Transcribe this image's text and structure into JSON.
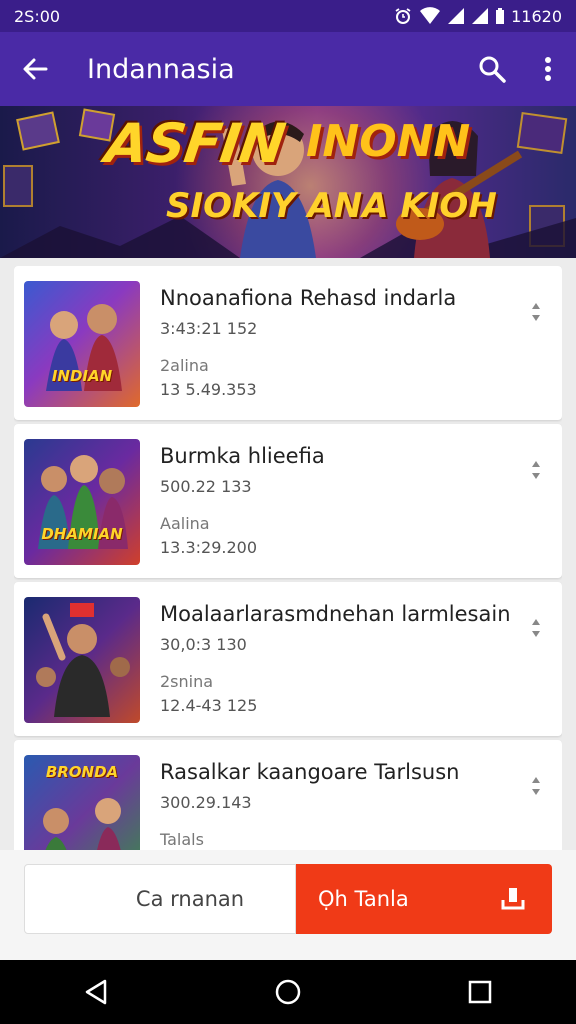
{
  "status_bar": {
    "time": "2S:00",
    "battery_text": "11620"
  },
  "app_bar": {
    "title": "Indannasia"
  },
  "banner": {
    "line1": "ASFIN",
    "line1b": "INONN",
    "line2": "SIOKIY ANA KIOH"
  },
  "items": [
    {
      "title": "Nnoanafiona Rehasd indarla",
      "sub1": "3:43:21 152",
      "label": "2alina",
      "sub2": "13 5.49.353",
      "thumb_text": "INDIAN"
    },
    {
      "title": "Burmka hlieefia",
      "sub1": "500.22 133",
      "label": "Aalina",
      "sub2": "13.3:29.200",
      "thumb_text": "DHAMIAN"
    },
    {
      "title": "Moalaarlarasmdnehan larmlesain",
      "sub1": "30,0:3 130",
      "label": "2snina",
      "sub2": "12.4-43 125",
      "thumb_text": ""
    },
    {
      "title": "Rasalkar kaangoare Tarlsusn",
      "sub1": "300.29.143",
      "label": "Talals",
      "sub2": "",
      "thumb_text": "BRONDA"
    }
  ],
  "bottom": {
    "cancel_label": "Ca rnanan",
    "primary_label": "Ọh Tanla"
  },
  "colors": {
    "status_bar": "#3a1e8a",
    "app_bar": "#4a2aa6",
    "primary_button": "#f03a17"
  }
}
